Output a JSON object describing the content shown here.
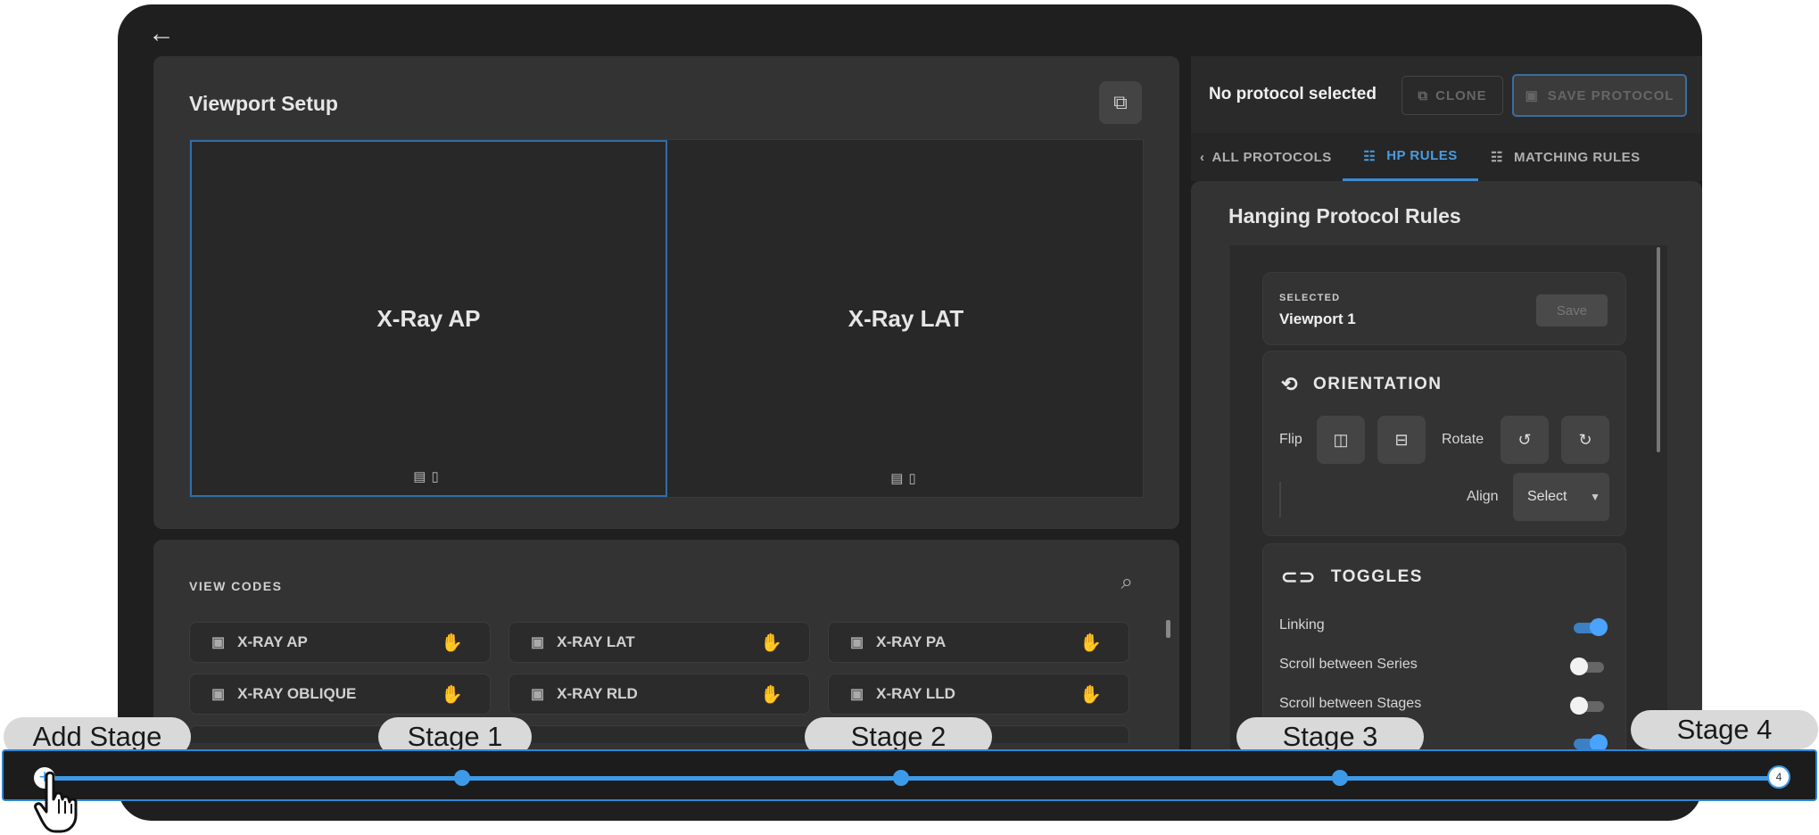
{
  "viewport_setup": {
    "title": "Viewport Setup",
    "viewports": [
      {
        "label": "X-Ray AP",
        "selected": true
      },
      {
        "label": "X-Ray LAT",
        "selected": false
      }
    ]
  },
  "view_codes": {
    "title": "VIEW CODES",
    "items": [
      "X-RAY AP",
      "X-RAY LAT",
      "X-RAY PA",
      "X-RAY OBLIQUE",
      "X-RAY RLD",
      "X-RAY LLD"
    ]
  },
  "protocol_bar": {
    "status": "No protocol selected",
    "clone_label": "CLONE",
    "save_label": "SAVE PROTOCOL"
  },
  "tabs": [
    {
      "label": "ALL PROTOCOLS",
      "active": false
    },
    {
      "label": "HP RULES",
      "active": true
    },
    {
      "label": "MATCHING RULES",
      "active": false
    }
  ],
  "rules": {
    "title": "Hanging Protocol Rules",
    "selected_label": "SELECTED",
    "selected_value": "Viewport 1",
    "save_label": "Save",
    "orientation": {
      "title": "ORIENTATION",
      "flip_label": "Flip",
      "rotate_label": "Rotate",
      "align_label": "Align",
      "align_value": "Select"
    },
    "toggles": {
      "title": "TOGGLES",
      "items": [
        {
          "label": "Linking",
          "on": true
        },
        {
          "label": "Scroll between Series",
          "on": false
        },
        {
          "label": "Scroll between Stages",
          "on": false
        }
      ]
    }
  },
  "timeline": {
    "add_label": "Add Stage",
    "stages": [
      "Stage 1",
      "Stage 2",
      "Stage 3",
      "Stage 4"
    ],
    "end_count": "4",
    "accent": "#3d9ae8"
  }
}
